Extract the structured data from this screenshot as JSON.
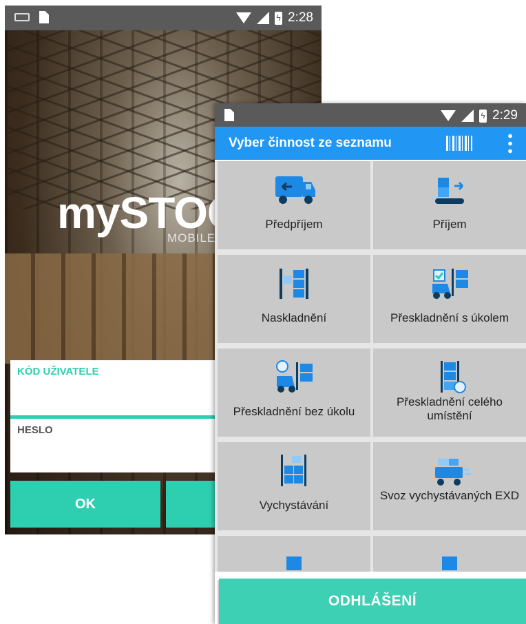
{
  "login": {
    "status": {
      "time": "2:28"
    },
    "logo": "mySTOC",
    "logo_sub": "MOBILE",
    "user_label": "KÓD UŽIVATELE",
    "password_label": "HESLO",
    "ok_label": "OK"
  },
  "menu": {
    "status": {
      "time": "2:29"
    },
    "title": "Vyber činnost ze seznamu",
    "items": [
      {
        "label": "Předpříjem",
        "icon": "truck-icon"
      },
      {
        "label": "Příjem",
        "icon": "conveyor-icon"
      },
      {
        "label": "Naskladnění",
        "icon": "shelf-stock-icon"
      },
      {
        "label": "Přeskladnění s úkolem",
        "icon": "forklift-task-icon"
      },
      {
        "label": "Přeskladnění bez úkolu",
        "icon": "forklift-icon"
      },
      {
        "label": "Přeskladnění celého umístění",
        "icon": "rack-move-icon"
      },
      {
        "label": "Vychystávání",
        "icon": "picking-icon"
      },
      {
        "label": "Svoz vychystávaných EXD",
        "icon": "cart-icon"
      }
    ],
    "logout_label": "ODHLÁŠENÍ"
  },
  "colors": {
    "accent": "#2ecfb0",
    "appbar": "#2196f3",
    "icon_blue": "#1e88e5"
  }
}
